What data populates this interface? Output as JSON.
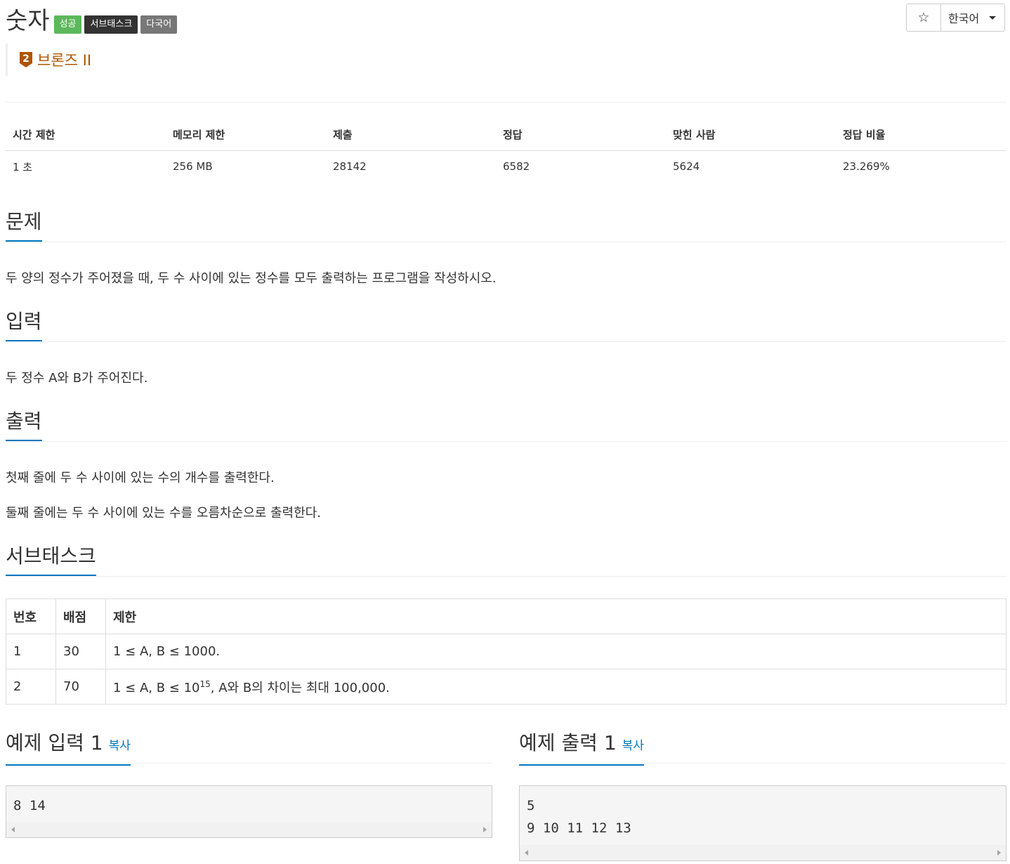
{
  "problem": {
    "title": "숫자",
    "labels": [
      {
        "text": "성공",
        "color": "#5cb85c"
      },
      {
        "text": "서브태스크",
        "color": "#333333"
      },
      {
        "text": "다국어",
        "color": "#777777"
      }
    ],
    "tier": {
      "level_digit": "2",
      "text": "브론즈 II",
      "color": "#ad5600"
    }
  },
  "controls": {
    "star_glyph": "☆",
    "language": "한국어"
  },
  "info": {
    "headers": [
      "시간 제한",
      "메모리 제한",
      "제출",
      "정답",
      "맞힌 사람",
      "정답 비율"
    ],
    "values": [
      "1 초",
      "256 MB",
      "28142",
      "6582",
      "5624",
      "23.269%"
    ]
  },
  "sections": {
    "problem": {
      "heading": "문제",
      "text": "두 양의 정수가 주어졌을 때, 두 수 사이에 있는 정수를 모두 출력하는 프로그램을 작성하시오."
    },
    "input": {
      "heading": "입력",
      "text": "두 정수 A와 B가 주어진다."
    },
    "output": {
      "heading": "출력",
      "lines": [
        "첫째 줄에 두 수 사이에 있는 수의 개수를 출력한다.",
        "둘째 줄에는 두 수 사이에 있는 수를 오름차순으로 출력한다."
      ]
    },
    "subtask": {
      "heading": "서브태스크",
      "headers": [
        "번호",
        "배점",
        "제한"
      ],
      "rows": [
        {
          "num": "1",
          "score": "30",
          "limit": "1 ≤ A, B ≤ 1000."
        },
        {
          "num": "2",
          "score": "70",
          "limit_pre": "1 ≤ A, B ≤ 10",
          "limit_sup": "15",
          "limit_post": ", A와 B의 차이는 최대 100,000."
        }
      ]
    }
  },
  "samples": {
    "input": {
      "heading": "예제 입력 1",
      "copy": "복사",
      "content": "8 14"
    },
    "output": {
      "heading": "예제 출력 1",
      "copy": "복사",
      "content": "5\n9 10 11 12 13"
    }
  },
  "accent_color": "#0076c0"
}
